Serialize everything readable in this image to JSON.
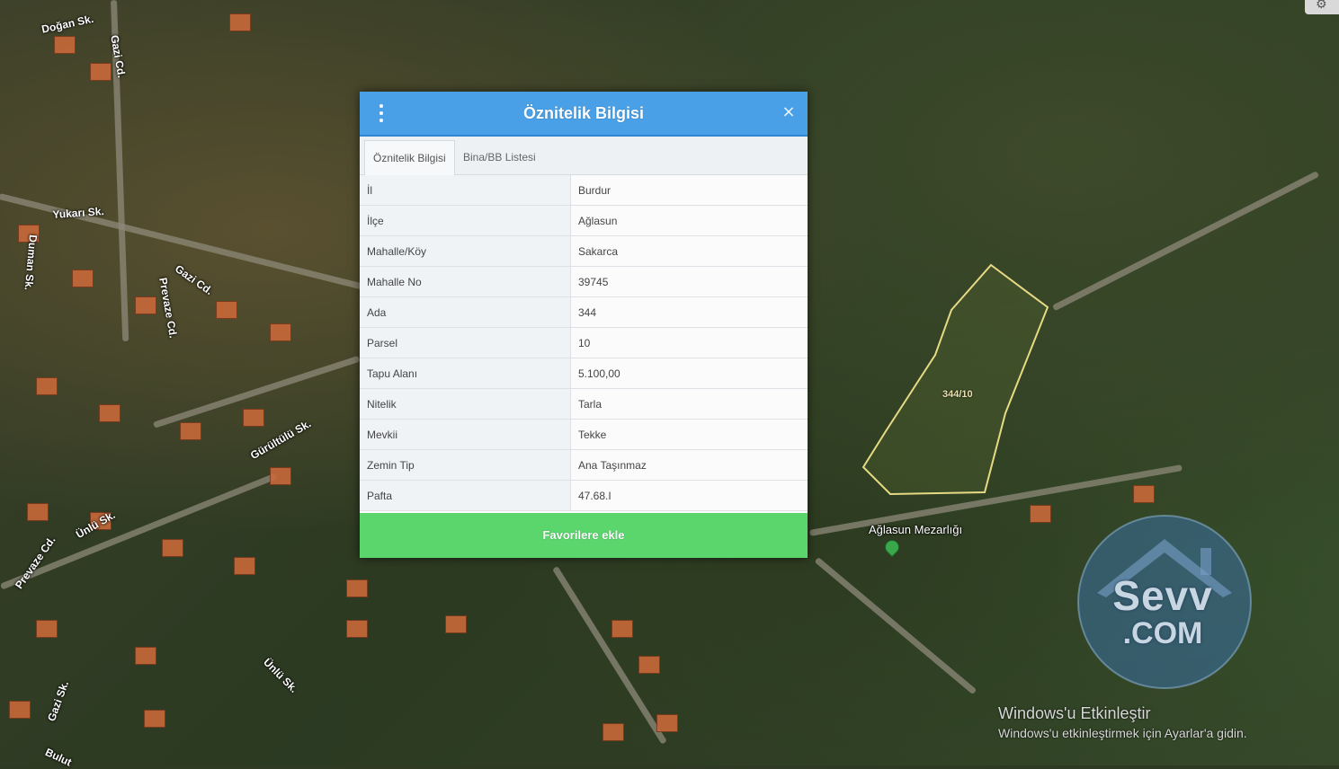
{
  "map": {
    "street_labels": [
      "Doğan Sk.",
      "Gazi Cd.",
      "Yukarı Sk.",
      "Duman Sk.",
      "Gazi Cd.",
      "Prevaze Cd.",
      "Gürültülü Sk.",
      "Ünlü Sk.",
      "Prevaze Cd.",
      "Ünlü Sk.",
      "Gazi Sk.",
      "Bulut"
    ],
    "parcel_label": "344/10",
    "cemetery_label": "Ağlasun Mezarlığı",
    "settings_icon": "gear-icon"
  },
  "modal": {
    "title": "Öznitelik Bilgisi",
    "menu_icon": "vertical-dots-icon",
    "close_icon": "close-icon",
    "close_glyph": "×",
    "tabs": [
      {
        "label": "Öznitelik Bilgisi",
        "active": true
      },
      {
        "label": "Bina/BB Listesi",
        "active": false
      }
    ],
    "rows": [
      {
        "key": "İl",
        "value": "Burdur"
      },
      {
        "key": "İlçe",
        "value": "Ağlasun"
      },
      {
        "key": "Mahalle/Köy",
        "value": "Sakarca"
      },
      {
        "key": "Mahalle No",
        "value": "39745"
      },
      {
        "key": "Ada",
        "value": "344"
      },
      {
        "key": "Parsel",
        "value": "10"
      },
      {
        "key": "Tapu Alanı",
        "value": "5.100,00"
      },
      {
        "key": "Nitelik",
        "value": "Tarla"
      },
      {
        "key": "Mevkii",
        "value": "Tekke"
      },
      {
        "key": "Zemin Tip",
        "value": "Ana Taşınmaz"
      },
      {
        "key": "Pafta",
        "value": "47.68.I"
      }
    ],
    "favorite_button": "Favorilere ekle",
    "colors": {
      "header": "#4aa0e6",
      "favorite": "#5ad66d"
    }
  },
  "watermark": {
    "line1": "Sevv",
    "line2": ".COM"
  },
  "windows_activation": {
    "title": "Windows'u Etkinleştir",
    "subtitle": "Windows'u etkinleştirmek için Ayarlar'a gidin."
  }
}
